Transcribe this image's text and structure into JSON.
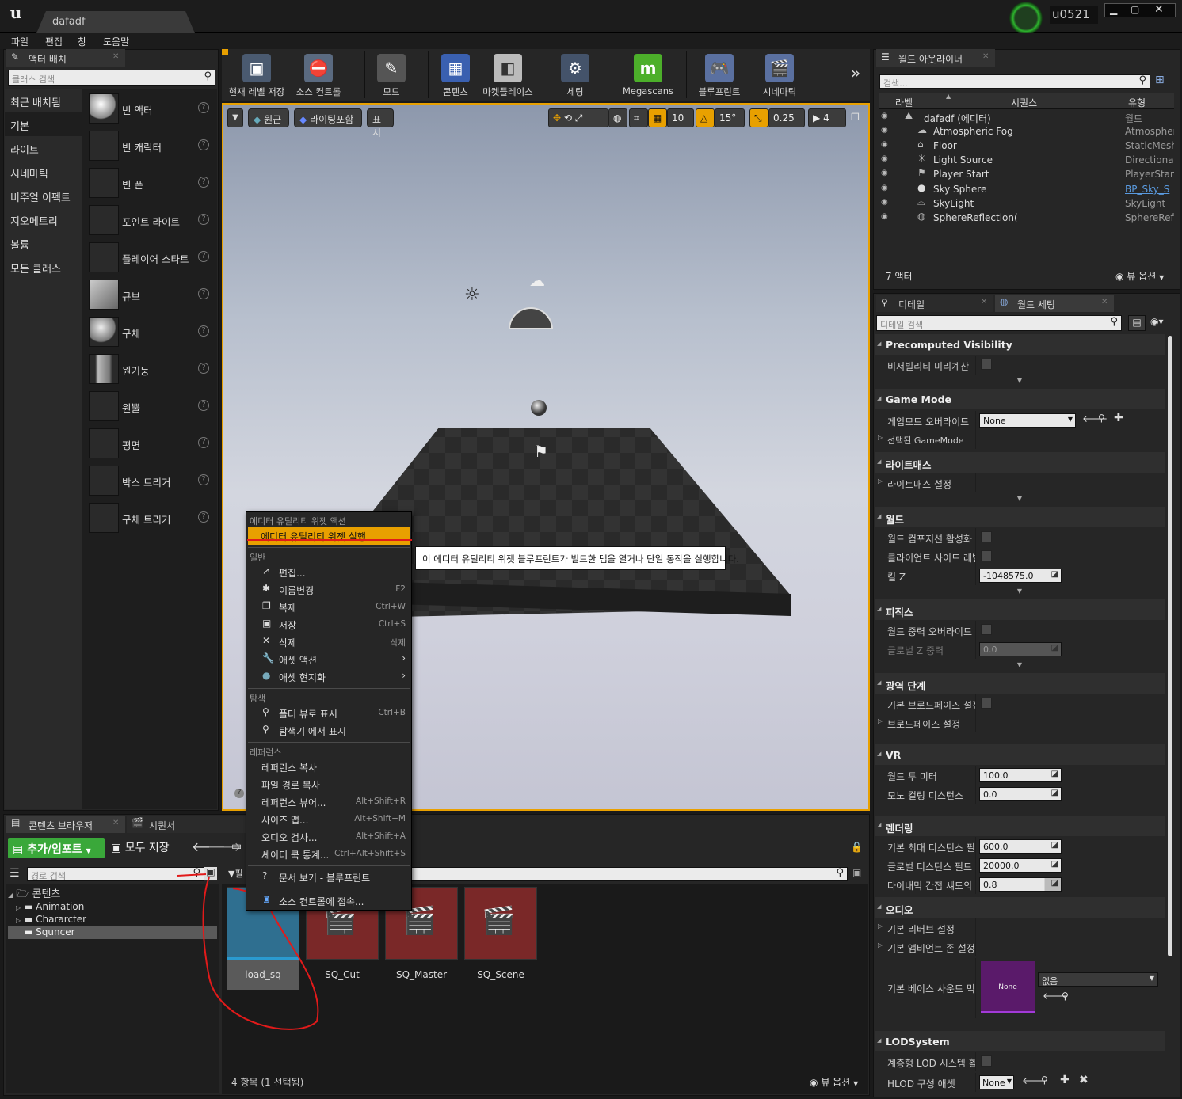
{
  "window": {
    "project_tab": "dafadf",
    "user": "u0521"
  },
  "menu": [
    "파일",
    "편집",
    "창",
    "도움말"
  ],
  "place_panel": {
    "tab": "액터 배치",
    "search_placeholder": "클래스 검색",
    "categories": [
      "최근 배치됨",
      "기본",
      "라이트",
      "시네마틱",
      "비주얼 이펙트",
      "지오메트리",
      "볼륨",
      "모든 클래스"
    ],
    "items": [
      "빈 액터",
      "빈 캐릭터",
      "빈 폰",
      "포인트 라이트",
      "플레이어 스타트",
      "큐브",
      "구체",
      "원기둥",
      "원뿔",
      "평면",
      "박스 트리거",
      "구체 트리거"
    ]
  },
  "toolbar": [
    "현재 레벨 저장",
    "소스 컨트롤",
    "모드",
    "콘텐츠",
    "마켓플레이스",
    "세팅",
    "Megascans",
    "블루프린트",
    "시네마틱"
  ],
  "viewport": {
    "perspective": "원근",
    "lighting": "라이팅포함",
    "show": "표시",
    "grid_snap": "10",
    "rot_snap": "15°",
    "scale_snap": "0.25",
    "cam_speed": "4"
  },
  "outliner": {
    "tab": "월드 아웃라이너",
    "search_placeholder": "검색...",
    "col_label": "라벨",
    "col_sequence": "시퀀스",
    "col_type": "유형",
    "rows": [
      {
        "name": "dafadf (에디터)",
        "type": "월드"
      },
      {
        "name": "Atmospheric Fog",
        "type": "Atmospher"
      },
      {
        "name": "Floor",
        "type": "StaticMesh"
      },
      {
        "name": "Light Source",
        "type": "Directional"
      },
      {
        "name": "Player Start",
        "type": "PlayerStart"
      },
      {
        "name": "Sky Sphere",
        "type": "BP_Sky_S"
      },
      {
        "name": "SkyLight",
        "type": "SkyLight"
      },
      {
        "name": "SphereReflection(",
        "type": "SphereRefl"
      }
    ],
    "count": "7 액터",
    "view_options": "뷰 옵션"
  },
  "details": {
    "tab_details": "디테일",
    "tab_world": "월드 세팅",
    "search_placeholder": "디테일 검색",
    "sections": {
      "precomputed": "Precomputed Visibility",
      "vis_precompute": "비저빌리티 미리계산",
      "game_mode": "Game Mode",
      "gm_override": "게임모드 오버라이드",
      "gm_value": "None",
      "selected_gm": "선택된 GameMode",
      "lightmass": "라이트매스",
      "lightmass_settings": "라이트매스 설정",
      "world": "월드",
      "world_comp": "월드 컴포지션 활성화",
      "client_side": "클라이언트 사이드 레벨 스",
      "kill_z": "킬 Z",
      "kill_z_val": "-1048575.0",
      "physics": "피직스",
      "gravity_override": "월드 중력 오버라이드",
      "global_gravity": "글로벌 Z 중력",
      "global_gravity_val": "0.0",
      "broadphase": "광역 단계",
      "default_broadphase": "기본 브로드페이즈 설정 오",
      "broadphase_settings": "브로드페이즈 설정",
      "vr": "VR",
      "world_to_meters": "월드 투 미터",
      "wtm_val": "100.0",
      "mono_cull": "모노 컬링 디스턴스",
      "mono_val": "0.0",
      "rendering": "렌더링",
      "max_dist": "기본 최대 디스턴스 필드",
      "max_dist_val": "600.0",
      "global_dist": "글로벌 디스턴스 필드 뷰",
      "global_dist_val": "20000.0",
      "dyn_shadow": "다이내믹 간접 섀도의 최",
      "dyn_shadow_val": "0.8",
      "audio": "오디오",
      "reverb": "기본 리버브 설정",
      "ambient": "기본 앰비언트 존 설정",
      "base_sound_mix": "기본 베이스 사운드 믹스",
      "sound_none": "None",
      "sound_select": "없음",
      "lod": "LODSystem",
      "hlod_enable": "계층형 LOD 시스템 활성",
      "hlod_asset": "HLOD 구성 애셋",
      "hlod_val": "None"
    }
  },
  "content_browser": {
    "tab": "콘텐츠 브라우저",
    "tab2": "시퀀서",
    "add_import": "추가/임포트",
    "save_all": "모두 저장",
    "path_search": "경로 검색",
    "tree_root": "콘텐츠",
    "folders": [
      "Animation",
      "Chararcter",
      "Squncer"
    ],
    "filter_label": "필",
    "assets": [
      "load_sq",
      "SQ_Cut",
      "SQ_Master",
      "SQ_Scene"
    ],
    "status": "4 항목 (1 선택됨)",
    "view_options": "뷰 옵션"
  },
  "context_menu": {
    "head_widget": "에디터 유틸리티 위젯 액션",
    "run_widget": "에디터 유틸리티 위젯 실행",
    "head_general": "일반",
    "general": [
      {
        "icon": "↗",
        "label": "편집...",
        "shortcut": ""
      },
      {
        "icon": "✱",
        "label": "이름변경",
        "shortcut": "F2"
      },
      {
        "icon": "❐",
        "label": "복제",
        "shortcut": "Ctrl+W"
      },
      {
        "icon": "▣",
        "label": "저장",
        "shortcut": "Ctrl+S"
      },
      {
        "icon": "✕",
        "label": "삭제",
        "shortcut": "삭제"
      },
      {
        "icon": "🔧",
        "label": "애셋 액션",
        "shortcut": "›"
      },
      {
        "icon": "●",
        "label": "애셋 현지화",
        "shortcut": "›"
      }
    ],
    "head_explore": "탐색",
    "explore": [
      {
        "icon": "⚲",
        "label": "폴더 뷰로 표시",
        "shortcut": "Ctrl+B"
      },
      {
        "icon": "⚲",
        "label": "탐색기 에서 표시",
        "shortcut": ""
      }
    ],
    "head_reference": "레퍼런스",
    "reference": [
      {
        "label": "레퍼런스 복사",
        "shortcut": ""
      },
      {
        "label": "파일 경로 복사",
        "shortcut": ""
      },
      {
        "label": "레퍼런스 뷰어...",
        "shortcut": "Alt+Shift+R"
      },
      {
        "label": "사이즈 맵...",
        "shortcut": "Alt+Shift+M"
      },
      {
        "label": "오디오 검사...",
        "shortcut": "Alt+Shift+A"
      },
      {
        "label": "셰이더 쿡 통계...",
        "shortcut": "Ctrl+Alt+Shift+S"
      }
    ],
    "docs": "문서 보기 - 블루프린트",
    "source_control": "소스 컨트롤에 접속..."
  },
  "tooltip": "이 에디터 유틸리티 위젯 블루프린트가 빌드한 탭을 열거나 단일 동작을 실행합니다.",
  "colors": {
    "accent": "#f2a400",
    "green": "#3aa83a",
    "selection": "#e8a000"
  }
}
